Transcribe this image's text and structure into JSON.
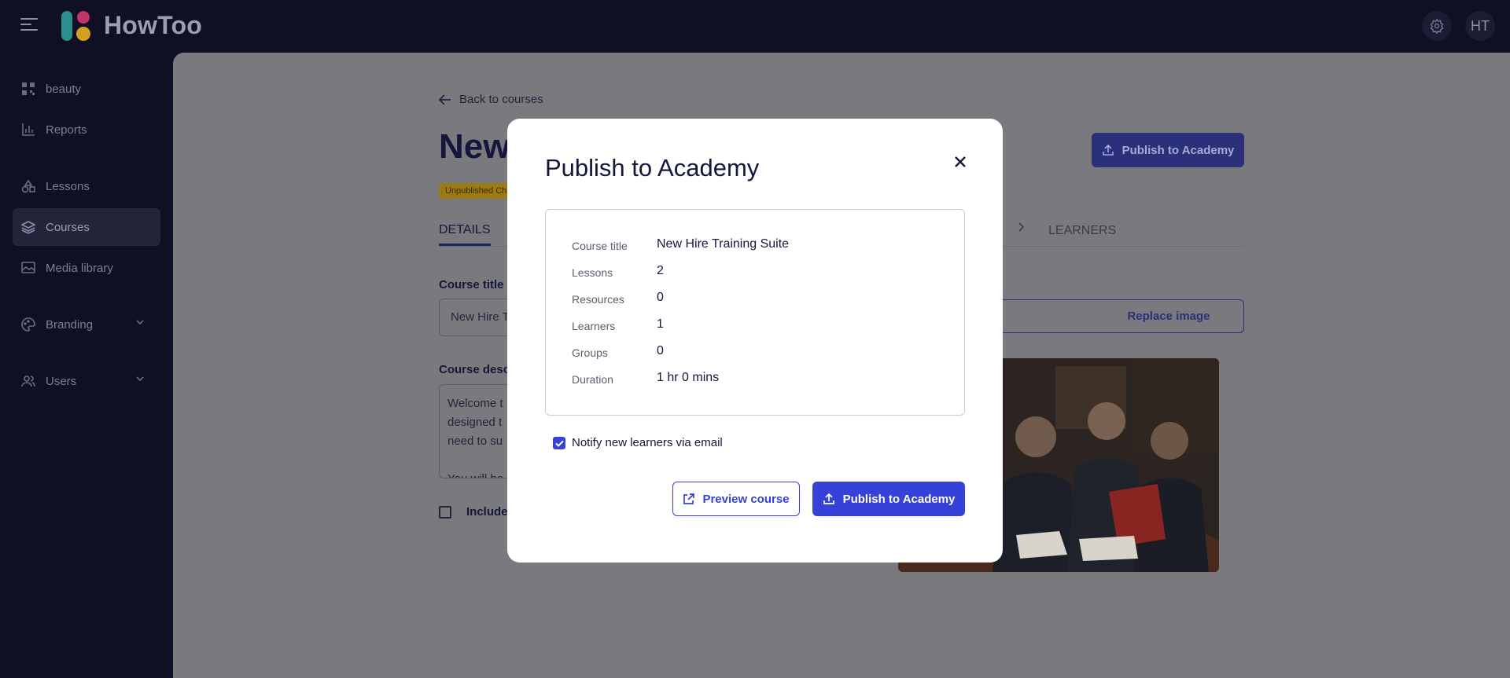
{
  "app": {
    "brand": "HowToo",
    "avatar_initials": "HT"
  },
  "sidebar": {
    "items": [
      {
        "label": "beauty"
      },
      {
        "label": "Reports"
      },
      {
        "label": "Lessons"
      },
      {
        "label": "Courses"
      },
      {
        "label": "Media library"
      },
      {
        "label": "Branding"
      },
      {
        "label": "Users"
      }
    ]
  },
  "page": {
    "back_link": "Back to courses",
    "title": "New",
    "status_badge": "Unpublished Ch",
    "tabs": {
      "details": "DETAILS",
      "learners": "LEARNERS"
    },
    "publish_button": "Publish to Academy",
    "course_title_label": "Course title",
    "course_title_value": "New Hire T",
    "course_description_label": "Course desc",
    "description_lines": [
      "Welcome t",
      "designed t",
      "need to su",
      "",
      "You will bo"
    ],
    "include_label": "Include",
    "replace_image_button": "Replace image"
  },
  "modal": {
    "title": "Publish to Academy",
    "summary": [
      {
        "key": "Course title",
        "value": "New Hire Training Suite"
      },
      {
        "key": "Lessons",
        "value": "2"
      },
      {
        "key": "Resources",
        "value": "0"
      },
      {
        "key": "Learners",
        "value": "1"
      },
      {
        "key": "Groups",
        "value": "0"
      },
      {
        "key": "Duration",
        "value": "1 hr 0 mins"
      }
    ],
    "notify_label": "Notify new learners via email",
    "notify_checked": true,
    "preview_button": "Preview course",
    "publish_button": "Publish to Academy"
  },
  "colors": {
    "accent": "#3541d8",
    "sidebar_bg": "#0f1024",
    "overlay_bg": "#7a7a7e",
    "title_text": "#14163a"
  }
}
